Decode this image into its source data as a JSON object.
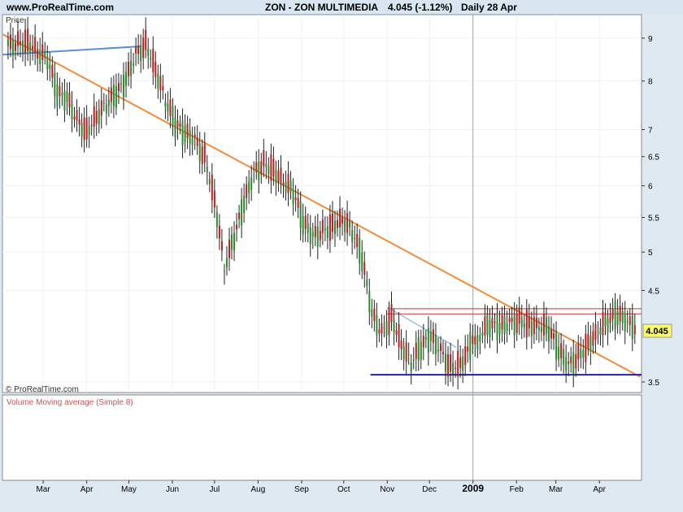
{
  "header": {
    "site": "www.ProRealTime.com",
    "title": "ZON - ZON MULTIMEDIA",
    "quote": "4.045 (-1.12%)",
    "period": "Daily  28 Apr"
  },
  "price_panel": {
    "label": "Price",
    "watermark": "© ProRealTime.com",
    "last_price_tag": "4.045"
  },
  "volume_panel": {
    "label": "Volume Moving average (Simple 8)"
  },
  "x_axis": {
    "months": [
      "Mar",
      "Apr",
      "May",
      "Jun",
      "Jul",
      "Aug",
      "Sep",
      "Oct",
      "Nov",
      "Dec",
      "2009",
      "Feb",
      "Mar",
      "Apr"
    ]
  },
  "y_axis": {
    "ticks": [
      "9",
      "8",
      "7",
      "6.5",
      "6",
      "5.5",
      "5",
      "4.5",
      "3.5"
    ]
  },
  "colors": {
    "background": "#ffffff",
    "frame_bg": "#dfe9f2",
    "bull_candle": "#2e8b2e",
    "bear_candle": "#b22222",
    "down_trendline": "#f28c3a",
    "resistance_lines": "#cc3333",
    "support_line": "#2222aa",
    "early_line": "#5b8fd6",
    "short_channel": "#6aa0e0",
    "volume_label": "#d05050"
  },
  "chart_data": {
    "type": "candlestick",
    "scale": "log",
    "ylim": [
      3.4,
      9.6
    ],
    "series_close": [
      [
        "2008-02-05",
        8.8
      ],
      [
        "2008-02-12",
        8.9
      ],
      [
        "2008-02-19",
        8.95
      ],
      [
        "2008-02-26",
        8.7
      ],
      [
        "2008-03-04",
        8.5
      ],
      [
        "2008-03-11",
        7.7
      ],
      [
        "2008-03-18",
        7.6
      ],
      [
        "2008-03-25",
        7.2
      ],
      [
        "2008-04-01",
        7.0
      ],
      [
        "2008-04-08",
        7.3
      ],
      [
        "2008-04-15",
        7.5
      ],
      [
        "2008-04-22",
        7.7
      ],
      [
        "2008-04-29",
        8.0
      ],
      [
        "2008-05-06",
        8.6
      ],
      [
        "2008-05-13",
        8.9
      ],
      [
        "2008-05-20",
        8.3
      ],
      [
        "2008-05-27",
        7.6
      ],
      [
        "2008-06-03",
        7.1
      ],
      [
        "2008-06-10",
        6.9
      ],
      [
        "2008-06-17",
        6.8
      ],
      [
        "2008-06-24",
        6.5
      ],
      [
        "2008-07-01",
        5.8
      ],
      [
        "2008-07-08",
        4.8
      ],
      [
        "2008-07-15",
        5.2
      ],
      [
        "2008-07-22",
        5.7
      ],
      [
        "2008-07-29",
        6.2
      ],
      [
        "2008-08-05",
        6.4
      ],
      [
        "2008-08-12",
        6.3
      ],
      [
        "2008-08-19",
        6.1
      ],
      [
        "2008-08-26",
        5.9
      ],
      [
        "2008-09-02",
        5.4
      ],
      [
        "2008-09-09",
        5.2
      ],
      [
        "2008-09-16",
        5.3
      ],
      [
        "2008-09-23",
        5.4
      ],
      [
        "2008-09-30",
        5.5
      ],
      [
        "2008-10-07",
        5.3
      ],
      [
        "2008-10-14",
        4.9
      ],
      [
        "2008-10-21",
        4.2
      ],
      [
        "2008-10-28",
        4.0
      ],
      [
        "2008-11-04",
        4.2
      ],
      [
        "2008-11-11",
        3.9
      ],
      [
        "2008-11-18",
        3.7
      ],
      [
        "2008-11-25",
        3.85
      ],
      [
        "2008-12-02",
        3.95
      ],
      [
        "2008-12-09",
        3.8
      ],
      [
        "2008-12-16",
        3.65
      ],
      [
        "2008-12-23",
        3.7
      ],
      [
        "2009-01-06",
        4.0
      ],
      [
        "2009-01-13",
        4.1
      ],
      [
        "2009-01-20",
        4.05
      ],
      [
        "2009-01-27",
        4.1
      ],
      [
        "2009-02-03",
        4.15
      ],
      [
        "2009-02-10",
        4.12
      ],
      [
        "2009-02-17",
        4.1
      ],
      [
        "2009-02-24",
        4.05
      ],
      [
        "2009-03-03",
        3.8
      ],
      [
        "2009-03-10",
        3.65
      ],
      [
        "2009-03-17",
        3.75
      ],
      [
        "2009-03-24",
        3.9
      ],
      [
        "2009-03-31",
        4.05
      ],
      [
        "2009-04-07",
        4.15
      ],
      [
        "2009-04-14",
        4.2
      ],
      [
        "2009-04-21",
        4.1
      ],
      [
        "2009-04-28",
        4.045
      ]
    ],
    "annotations": {
      "down_trendline": [
        [
          "2008-02-01",
          9.1
        ],
        [
          "2009-04-30",
          3.55
        ]
      ],
      "resistance_upper": 4.28,
      "resistance_lower": 4.22,
      "support": 3.57,
      "early_resistance": [
        [
          "2008-02-01",
          8.6
        ],
        [
          "2008-05-10",
          8.8
        ]
      ]
    }
  }
}
